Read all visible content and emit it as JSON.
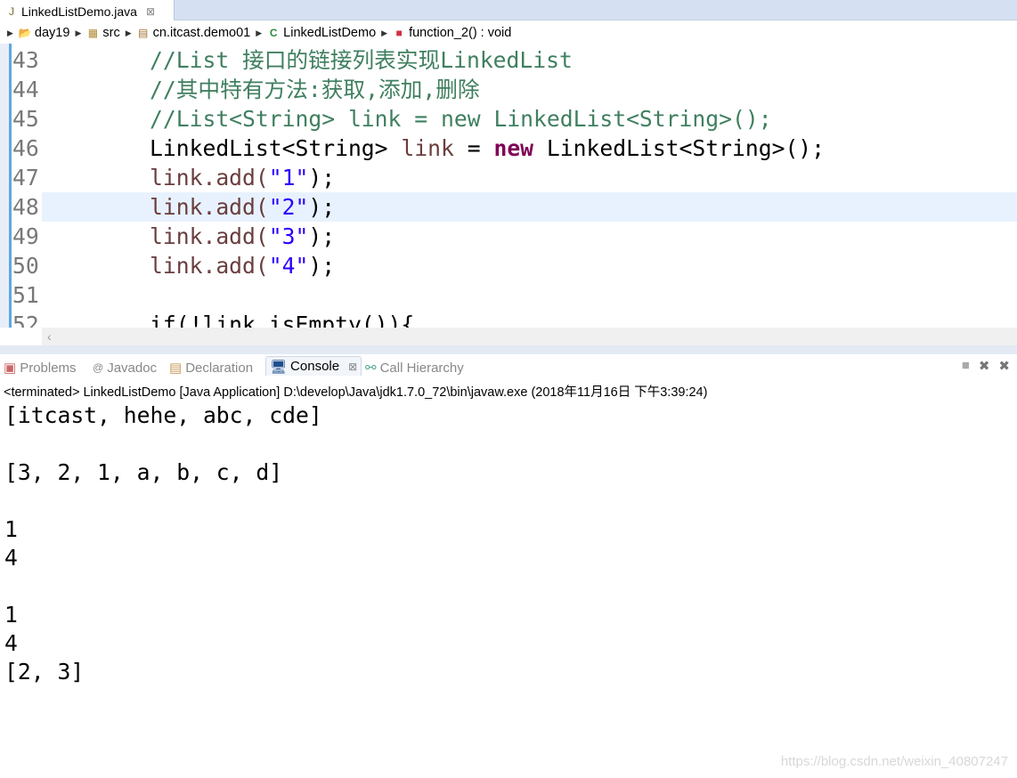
{
  "editor_tab": {
    "title": "LinkedListDemo.java",
    "close": "⊠"
  },
  "breadcrumb": [
    "day19",
    "src",
    "cn.itcast.demo01",
    "LinkedListDemo",
    "function_2() : void"
  ],
  "code_lines": [
    {
      "num": "43",
      "text": "//List 接口的链接列表实现LinkedList"
    },
    {
      "num": "44",
      "text": "//其中特有方法:获取,添加,删除"
    },
    {
      "num": "45",
      "text": "//List<String> link = new LinkedList<String>();"
    },
    {
      "num": "46",
      "a": "LinkedList<String> ",
      "b": "link",
      " c": "",
      "kw": "new",
      "d": " LinkedList<String>();"
    },
    {
      "num": "47",
      "pre": "link.add(",
      "str": "\"1\"",
      "post": ");"
    },
    {
      "num": "48",
      "pre": "link.add(",
      "str": "\"2\"",
      "post": ");"
    },
    {
      "num": "49",
      "pre": "link.add(",
      "str": "\"3\"",
      "post": ");"
    },
    {
      "num": "50",
      "pre": "link.add(",
      "str": "\"4\"",
      "post": ");"
    },
    {
      "num": "51",
      "text": ""
    },
    {
      "num": "52",
      "text": "if(!link.isEmpty()){"
    }
  ],
  "panel_tabs": [
    "Problems",
    "Javadoc",
    "Declaration",
    "Console",
    "Call Hierarchy"
  ],
  "console": {
    "status": "<terminated> LinkedListDemo [Java Application] D:\\develop\\Java\\jdk1.7.0_72\\bin\\javaw.exe (2018年11月16日 下午3:39:24)",
    "output": "[itcast, hehe, abc, cde]\n\n[3, 2, 1, a, b, c, d]\n\n1\n4\n\n1\n4\n[2, 3]"
  },
  "watermark": "https://blog.csdn.net/weixin_40807247"
}
